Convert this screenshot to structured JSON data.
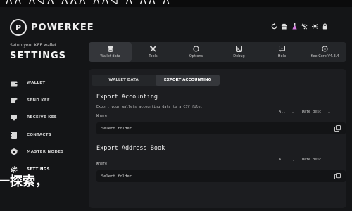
{
  "top_band": {
    "glyphs": "ᐱᐱ ᐱᐊᐱ ᐱᐱᐱ ᐱᐱᐊ ᐱ ᐱᐱ ᐱ"
  },
  "brand": {
    "logo": "P",
    "name": "POWERKEE"
  },
  "sidebar": {
    "tagline": "Setup your KEE wallet",
    "title": "SETTINGS",
    "items": [
      {
        "label": "WALLET",
        "icon": "wallet-icon"
      },
      {
        "label": "SEND KEE",
        "icon": "send-icon"
      },
      {
        "label": "RECEIVE KEE",
        "icon": "receive-icon"
      },
      {
        "label": "CONTACTS",
        "icon": "contacts-icon"
      },
      {
        "label": "MASTER NODES",
        "icon": "masternodes-icon"
      },
      {
        "label": "SETTINGS",
        "icon": "gear-icon",
        "active": true
      }
    ]
  },
  "overlay_text": "一探索，",
  "header_icons": [
    "refresh-icon",
    "gift-icon",
    "flask-icon",
    "no-wifi-icon",
    "sun-icon",
    "lock-icon"
  ],
  "tabs": [
    {
      "label": "Wallet data",
      "icon": "database-icon",
      "active": true
    },
    {
      "label": "Tools",
      "icon": "tools-icon"
    },
    {
      "label": "Options",
      "icon": "options-icon"
    },
    {
      "label": "Debug",
      "icon": "debug-icon"
    },
    {
      "label": "Help",
      "icon": "help-icon"
    },
    {
      "label": "Kee Core V4.3.4",
      "icon": "core-icon"
    }
  ],
  "subtabs": [
    {
      "label": "WALLET DATA"
    },
    {
      "label": "EXPORT ACCOUNTING",
      "active": true
    }
  ],
  "export_accounting": {
    "title": "Export Accounting",
    "description": "Export your wallets accounting data to a CSV file.",
    "where_label": "Where",
    "filter_value": "All",
    "sort_value": "Date desc",
    "folder_placeholder": "Select folder"
  },
  "export_address_book": {
    "title": "Export Address Book",
    "where_label": "Where",
    "filter_value": "All",
    "sort_value": "Date desc",
    "folder_placeholder": "Select folder"
  }
}
